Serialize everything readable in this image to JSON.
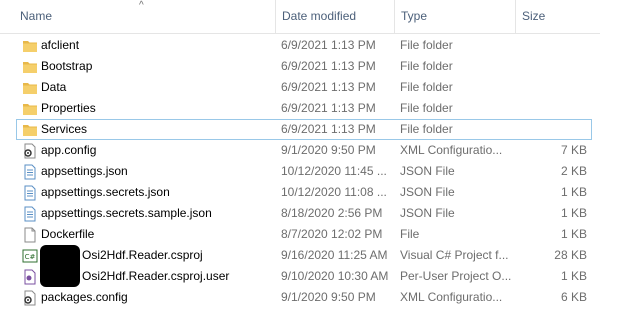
{
  "header": {
    "name": "Name",
    "date_modified": "Date modified",
    "type": "Type",
    "size": "Size",
    "sort_glyph": "^"
  },
  "files": [
    {
      "name": "afclient",
      "date": "6/9/2021 1:13 PM",
      "type": "File folder",
      "size": "",
      "icon": "folder-icon"
    },
    {
      "name": "Bootstrap",
      "date": "6/9/2021 1:13 PM",
      "type": "File folder",
      "size": "",
      "icon": "folder-icon"
    },
    {
      "name": "Data",
      "date": "6/9/2021 1:13 PM",
      "type": "File folder",
      "size": "",
      "icon": "folder-icon"
    },
    {
      "name": "Properties",
      "date": "6/9/2021 1:13 PM",
      "type": "File folder",
      "size": "",
      "icon": "folder-icon"
    },
    {
      "name": "Services",
      "date": "6/9/2021 1:13 PM",
      "type": "File folder",
      "size": "",
      "icon": "folder-icon"
    },
    {
      "name": "app.config",
      "date": "9/1/2020 9:50 PM",
      "type": "XML Configuratio...",
      "size": "7 KB",
      "icon": "config-file-icon"
    },
    {
      "name": "appsettings.json",
      "date": "10/12/2020 11:45 ...",
      "type": "JSON File",
      "size": "2 KB",
      "icon": "json-file-icon"
    },
    {
      "name": "appsettings.secrets.json",
      "date": "10/12/2020 11:08 ...",
      "type": "JSON File",
      "size": "1 KB",
      "icon": "json-file-icon"
    },
    {
      "name": "appsettings.secrets.sample.json",
      "date": "8/18/2020 2:56 PM",
      "type": "JSON File",
      "size": "1 KB",
      "icon": "json-file-icon"
    },
    {
      "name": "Dockerfile",
      "date": "8/7/2020 12:02 PM",
      "type": "File",
      "size": "1 KB",
      "icon": "blank-file-icon"
    },
    {
      "name": "Osi2Hdf.Reader.csproj",
      "date": "9/16/2020 11:25 AM",
      "type": "Visual C# Project f...",
      "size": "28 KB",
      "icon": "csharp-project-icon"
    },
    {
      "name": "Osi2Hdf.Reader.csproj.user",
      "date": "9/10/2020 10:30 AM",
      "type": "Per-User Project O...",
      "size": "1 KB",
      "icon": "user-project-icon"
    },
    {
      "name": "packages.config",
      "date": "9/1/2020 9:50 PM",
      "type": "XML Configuratio...",
      "size": "6 KB",
      "icon": "config-file-icon"
    }
  ],
  "colors": {
    "header_text": "#4c607a",
    "secondary_text": "#6d6d6d",
    "folder": "#e8b84a",
    "focus_border": "#99c8e8"
  }
}
